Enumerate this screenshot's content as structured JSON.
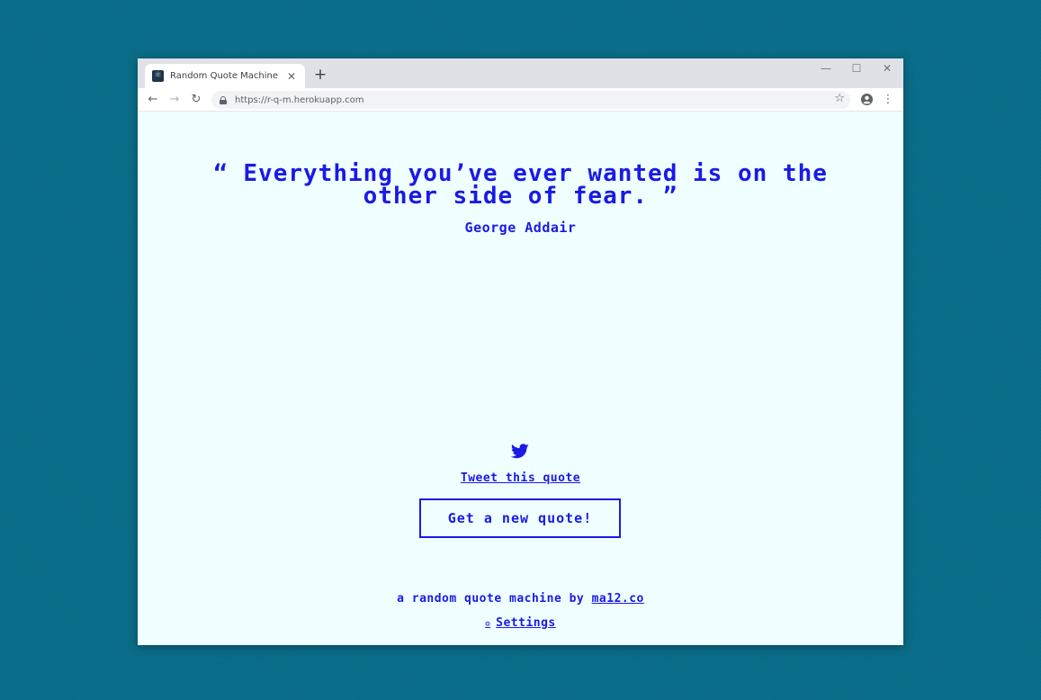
{
  "browser": {
    "tab_title": "Random Quote Machine",
    "favicon_glyph": "⚛",
    "close_glyph": "✕",
    "new_tab_glyph": "+",
    "minimize_glyph": "—",
    "maximize_glyph": "☐",
    "window_close_glyph": "✕",
    "back_glyph": "←",
    "forward_glyph": "→",
    "reload_glyph": "↻",
    "url": "https://r-q-m.herokuapp.com",
    "star_glyph": "☆",
    "menu_glyph": "⋮"
  },
  "quote": {
    "text": "“ Everything you’ve ever wanted is on the other side of fear. ”",
    "author": "George Addair"
  },
  "actions": {
    "tweet_label": "Tweet this quote",
    "new_quote_label": "Get a new quote!"
  },
  "footer": {
    "text": "a random quote machine by ",
    "link": "ma12.co",
    "settings_icon": "⚙",
    "settings_label": "Settings"
  },
  "colors": {
    "accent": "#1a1ae6",
    "page_background": "#f0ffff",
    "desktop_background": "#0a6e8a"
  }
}
